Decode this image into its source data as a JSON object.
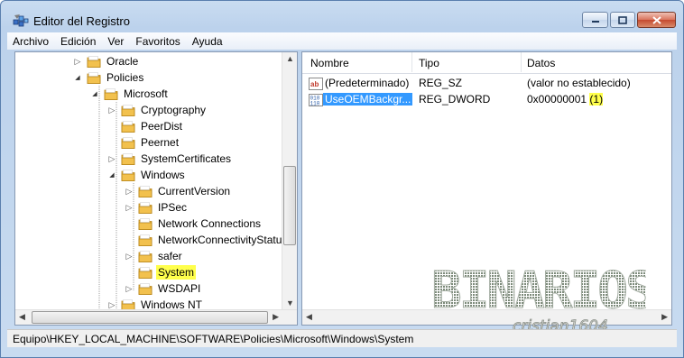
{
  "window": {
    "title": "Editor del Registro",
    "buttons": {
      "minimize": "minimize-icon",
      "maximize": "maximize-icon",
      "close": "close-icon"
    }
  },
  "menubar": [
    "Archivo",
    "Edición",
    "Ver",
    "Favoritos",
    "Ayuda"
  ],
  "tree": [
    {
      "label": "Oracle",
      "depth": 4,
      "expander": "collapsed",
      "selected": false
    },
    {
      "label": "Policies",
      "depth": 4,
      "expander": "expanded",
      "selected": false
    },
    {
      "label": "Microsoft",
      "depth": 5,
      "expander": "expanded",
      "selected": false
    },
    {
      "label": "Cryptography",
      "depth": 6,
      "expander": "collapsed",
      "selected": false
    },
    {
      "label": "PeerDist",
      "depth": 6,
      "expander": "none",
      "selected": false
    },
    {
      "label": "Peernet",
      "depth": 6,
      "expander": "none",
      "selected": false
    },
    {
      "label": "SystemCertificates",
      "depth": 6,
      "expander": "collapsed",
      "selected": false
    },
    {
      "label": "Windows",
      "depth": 6,
      "expander": "expanded",
      "selected": false
    },
    {
      "label": "CurrentVersion",
      "depth": 7,
      "expander": "collapsed",
      "selected": false
    },
    {
      "label": "IPSec",
      "depth": 7,
      "expander": "collapsed",
      "selected": false
    },
    {
      "label": "Network Connections",
      "depth": 7,
      "expander": "none",
      "selected": false
    },
    {
      "label": "NetworkConnectivityStatu",
      "depth": 7,
      "expander": "none",
      "selected": false
    },
    {
      "label": "safer",
      "depth": 7,
      "expander": "collapsed",
      "selected": false
    },
    {
      "label": "System",
      "depth": 7,
      "expander": "none",
      "selected": true
    },
    {
      "label": "WSDAPI",
      "depth": 7,
      "expander": "collapsed",
      "selected": false
    },
    {
      "label": "Windows NT",
      "depth": 6,
      "expander": "collapsed",
      "selected": false
    }
  ],
  "list": {
    "columns": [
      "Nombre",
      "Tipo",
      "Datos"
    ],
    "rows": [
      {
        "icon": "string-value-icon",
        "name": "(Predeterminado)",
        "type": "REG_SZ",
        "data": "(valor no establecido)",
        "data_highlight": "",
        "selected": false
      },
      {
        "icon": "binary-value-icon",
        "name": "UseOEMBackgr...",
        "type": "REG_DWORD",
        "data": "0x00000001",
        "data_highlight": "(1)",
        "selected": true
      }
    ]
  },
  "watermark": {
    "title": "BINARIOS",
    "subtitle": "cristian1604"
  },
  "statusbar": {
    "path": "Equipo\\HKEY_LOCAL_MACHINE\\SOFTWARE\\Policies\\Microsoft\\Windows\\System"
  },
  "colors": {
    "selection_highlight": "#ffff4c",
    "list_selection": "#3399ff",
    "folder": "#f2c14e"
  }
}
